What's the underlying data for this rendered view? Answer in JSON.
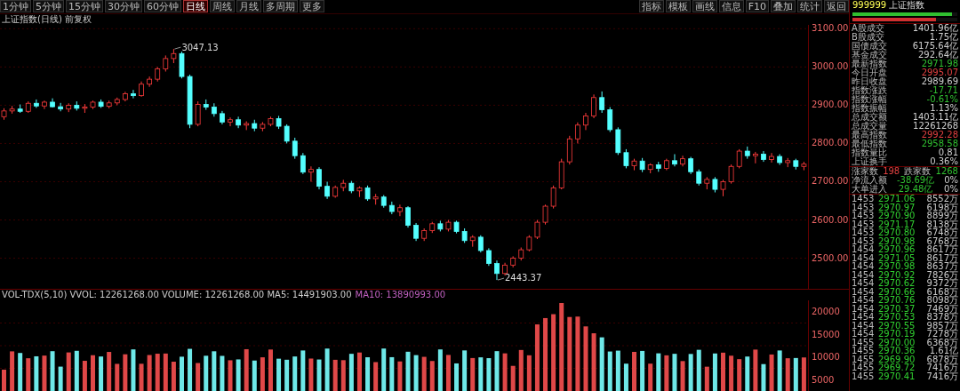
{
  "toolbar": {
    "periods": [
      {
        "label": "1分钟",
        "selected": false
      },
      {
        "label": "5分钟",
        "selected": false
      },
      {
        "label": "15分钟",
        "selected": false
      },
      {
        "label": "30分钟",
        "selected": false
      },
      {
        "label": "60分钟",
        "selected": false
      },
      {
        "label": "日线",
        "selected": true
      },
      {
        "label": "周线",
        "selected": false
      },
      {
        "label": "月线",
        "selected": false
      },
      {
        "label": "多周期",
        "selected": false
      },
      {
        "label": "更多",
        "selected": false
      }
    ],
    "tools": [
      "指标",
      "模板",
      "画线",
      "信息",
      "F10",
      "叠加",
      "统计",
      "返回"
    ]
  },
  "chart": {
    "title": "上证指数(日线)",
    "adjust": "前复权",
    "high_label": "3047.13",
    "low_label": "2443.37",
    "chart_data": {
      "type": "candlestick",
      "ylim": [
        2420,
        3110
      ],
      "grid": true,
      "yticks": [
        {
          "value": 3100,
          "label": "3100.00"
        },
        {
          "value": 3000,
          "label": "3000.00"
        },
        {
          "value": 2900,
          "label": "2900.00"
        },
        {
          "value": 2800,
          "label": "2800.00"
        },
        {
          "value": 2700,
          "label": "2700.00"
        },
        {
          "value": 2600,
          "label": "2600.00"
        },
        {
          "value": 2500,
          "label": "2500.00"
        }
      ],
      "ohlc": [
        [
          2870,
          2892,
          2862,
          2885
        ],
        [
          2885,
          2898,
          2878,
          2890
        ],
        [
          2890,
          2902,
          2880,
          2884
        ],
        [
          2884,
          2910,
          2880,
          2905
        ],
        [
          2905,
          2915,
          2893,
          2898
        ],
        [
          2898,
          2912,
          2890,
          2908
        ],
        [
          2908,
          2918,
          2894,
          2896
        ],
        [
          2896,
          2906,
          2884,
          2890
        ],
        [
          2890,
          2905,
          2882,
          2900
        ],
        [
          2900,
          2910,
          2886,
          2892
        ],
        [
          2892,
          2903,
          2880,
          2895
        ],
        [
          2895,
          2912,
          2890,
          2908
        ],
        [
          2908,
          2915,
          2893,
          2897
        ],
        [
          2897,
          2912,
          2892,
          2906
        ],
        [
          2906,
          2920,
          2900,
          2915
        ],
        [
          2915,
          2935,
          2910,
          2930
        ],
        [
          2930,
          2940,
          2918,
          2925
        ],
        [
          2925,
          2962,
          2922,
          2955
        ],
        [
          2955,
          2975,
          2948,
          2968
        ],
        [
          2968,
          3000,
          2962,
          2995
        ],
        [
          2995,
          3030,
          2988,
          3022
        ],
        [
          3022,
          3047,
          3010,
          3035
        ],
        [
          3035,
          3040,
          2970,
          2975
        ],
        [
          2975,
          2980,
          2840,
          2850
        ],
        [
          2850,
          2910,
          2845,
          2902
        ],
        [
          2902,
          2915,
          2888,
          2895
        ],
        [
          2895,
          2905,
          2870,
          2878
        ],
        [
          2878,
          2885,
          2850,
          2856
        ],
        [
          2856,
          2868,
          2845,
          2862
        ],
        [
          2862,
          2870,
          2840,
          2848
        ],
        [
          2848,
          2858,
          2835,
          2852
        ],
        [
          2852,
          2862,
          2832,
          2840
        ],
        [
          2840,
          2856,
          2832,
          2850
        ],
        [
          2850,
          2870,
          2845,
          2865
        ],
        [
          2865,
          2872,
          2838,
          2845
        ],
        [
          2845,
          2850,
          2800,
          2806
        ],
        [
          2806,
          2815,
          2760,
          2768
        ],
        [
          2768,
          2775,
          2720,
          2725
        ],
        [
          2725,
          2740,
          2700,
          2732
        ],
        [
          2732,
          2738,
          2680,
          2688
        ],
        [
          2688,
          2700,
          2655,
          2662
        ],
        [
          2662,
          2690,
          2658,
          2685
        ],
        [
          2685,
          2705,
          2675,
          2696
        ],
        [
          2696,
          2702,
          2670,
          2676
        ],
        [
          2676,
          2688,
          2660,
          2684
        ],
        [
          2684,
          2690,
          2650,
          2655
        ],
        [
          2655,
          2668,
          2640,
          2660
        ],
        [
          2660,
          2665,
          2632,
          2638
        ],
        [
          2638,
          2648,
          2615,
          2622
        ],
        [
          2622,
          2640,
          2610,
          2632
        ],
        [
          2632,
          2636,
          2580,
          2586
        ],
        [
          2586,
          2592,
          2545,
          2552
        ],
        [
          2552,
          2578,
          2545,
          2572
        ],
        [
          2572,
          2595,
          2566,
          2590
        ],
        [
          2590,
          2598,
          2570,
          2576
        ],
        [
          2576,
          2600,
          2570,
          2594
        ],
        [
          2594,
          2598,
          2565,
          2570
        ],
        [
          2570,
          2578,
          2540,
          2546
        ],
        [
          2546,
          2560,
          2530,
          2555
        ],
        [
          2555,
          2560,
          2515,
          2520
        ],
        [
          2520,
          2526,
          2480,
          2486
        ],
        [
          2486,
          2494,
          2443,
          2460
        ],
        [
          2460,
          2488,
          2455,
          2482
        ],
        [
          2482,
          2505,
          2476,
          2500
        ],
        [
          2500,
          2528,
          2494,
          2522
        ],
        [
          2522,
          2560,
          2518,
          2555
        ],
        [
          2555,
          2600,
          2550,
          2594
        ],
        [
          2594,
          2640,
          2588,
          2636
        ],
        [
          2636,
          2690,
          2630,
          2684
        ],
        [
          2684,
          2760,
          2680,
          2752
        ],
        [
          2752,
          2820,
          2745,
          2812
        ],
        [
          2812,
          2855,
          2800,
          2848
        ],
        [
          2848,
          2880,
          2835,
          2872
        ],
        [
          2872,
          2928,
          2866,
          2920
        ],
        [
          2920,
          2936,
          2880,
          2888
        ],
        [
          2888,
          2895,
          2830,
          2836
        ],
        [
          2836,
          2842,
          2770,
          2776
        ],
        [
          2776,
          2785,
          2735,
          2742
        ],
        [
          2742,
          2760,
          2730,
          2754
        ],
        [
          2754,
          2762,
          2725,
          2732
        ],
        [
          2732,
          2748,
          2722,
          2744
        ],
        [
          2744,
          2752,
          2726,
          2735
        ],
        [
          2735,
          2760,
          2730,
          2755
        ],
        [
          2755,
          2772,
          2740,
          2746
        ],
        [
          2746,
          2768,
          2740,
          2760
        ],
        [
          2760,
          2765,
          2720,
          2726
        ],
        [
          2726,
          2732,
          2690,
          2696
        ],
        [
          2696,
          2712,
          2680,
          2706
        ],
        [
          2706,
          2712,
          2672,
          2680
        ],
        [
          2680,
          2705,
          2662,
          2700
        ],
        [
          2700,
          2745,
          2695,
          2740
        ],
        [
          2740,
          2785,
          2735,
          2780
        ],
        [
          2780,
          2792,
          2760,
          2768
        ],
        [
          2768,
          2778,
          2748,
          2772
        ],
        [
          2772,
          2780,
          2752,
          2758
        ],
        [
          2758,
          2775,
          2750,
          2766
        ],
        [
          2766,
          2772,
          2744,
          2750
        ],
        [
          2750,
          2762,
          2738,
          2755
        ],
        [
          2755,
          2760,
          2732,
          2740
        ],
        [
          2740,
          2752,
          2730,
          2746
        ]
      ]
    }
  },
  "volume": {
    "header": "VOL-TDX(5,10) VVOL: 12261268.00 VOLUME: 12261268.00 MA5: 14491903.00",
    "header_highlight": "MA10: 13890993.00",
    "axis": [
      "20000",
      "15000",
      "10000",
      "5000"
    ]
  },
  "quote": {
    "code": "999999",
    "name": "上证指数",
    "meters": [
      {
        "kind": "buy",
        "level": 0.95
      },
      {
        "kind": "sell",
        "level": 0.8
      }
    ],
    "stats": [
      {
        "label": "A股成交",
        "value": "1401.96亿",
        "color": "#d0d0d0"
      },
      {
        "label": "B股成交",
        "value": "1.75亿",
        "color": "#d0d0d0"
      },
      {
        "label": "国债成交",
        "value": "6175.64亿",
        "color": "#d0d0d0"
      },
      {
        "label": "基金成交",
        "value": "292.64亿",
        "color": "#d0d0d0"
      },
      {
        "label": "最新指数",
        "value": "2971.98",
        "color": "#30c030"
      },
      {
        "label": "今日开盘",
        "value": "2995.07",
        "color": "#e04040"
      },
      {
        "label": "昨日收盘",
        "value": "2989.69",
        "color": "#d0d0d0"
      },
      {
        "label": "指数涨跌",
        "value": "-17.71",
        "color": "#30c030"
      },
      {
        "label": "指数涨幅",
        "value": "-0.61%",
        "color": "#30c030"
      },
      {
        "label": "指数振幅",
        "value": "1.13%",
        "color": "#d0d0d0"
      },
      {
        "label": "总成交额",
        "value": "1403.11亿",
        "color": "#d0d0d0"
      },
      {
        "label": "总成交量",
        "value": "12261268",
        "color": "#d0d0d0"
      },
      {
        "label": "最高指数",
        "value": "2992.28",
        "color": "#e04040"
      },
      {
        "label": "最低指数",
        "value": "2958.58",
        "color": "#30c030"
      },
      {
        "label": "指数量比",
        "value": "0.81",
        "color": "#d0d0d0"
      },
      {
        "label": "上证换手",
        "value": "0.36%",
        "color": "#d0d0d0"
      }
    ],
    "breadth": {
      "up_label": "涨家数",
      "up": "198",
      "down_label": "跌家数",
      "down": "1268"
    },
    "flows": [
      {
        "label": "净流入额",
        "value": "-38.69亿",
        "pct": "0%"
      },
      {
        "label": "大单进入",
        "value": "29.48亿",
        "pct": "0%"
      }
    ],
    "ticks": [
      {
        "time": "1453",
        "price": "2971.06",
        "volume": "8552万"
      },
      {
        "time": "1453",
        "price": "2970.97",
        "volume": "6198万"
      },
      {
        "time": "1453",
        "price": "2970.90",
        "volume": "8899万"
      },
      {
        "time": "1453",
        "price": "2971.17",
        "volume": "8138万"
      },
      {
        "time": "1453",
        "price": "2970.80",
        "volume": "6748万"
      },
      {
        "time": "1453",
        "price": "2970.98",
        "volume": "6768万"
      },
      {
        "time": "1454",
        "price": "2970.96",
        "volume": "8617万"
      },
      {
        "time": "1454",
        "price": "2971.05",
        "volume": "8617万"
      },
      {
        "time": "1454",
        "price": "2970.98",
        "volume": "8637万"
      },
      {
        "time": "1454",
        "price": "2970.92",
        "volume": "7826万"
      },
      {
        "time": "1454",
        "price": "2970.62",
        "volume": "9372万"
      },
      {
        "time": "1454",
        "price": "2970.66",
        "volume": "6168万"
      },
      {
        "time": "1454",
        "price": "2970.76",
        "volume": "8098万"
      },
      {
        "time": "1454",
        "price": "2970.37",
        "volume": "7469万"
      },
      {
        "time": "1454",
        "price": "2970.53",
        "volume": "8378万"
      },
      {
        "time": "1454",
        "price": "2970.55",
        "volume": "9857万"
      },
      {
        "time": "1454",
        "price": "2970.19",
        "volume": "7278万"
      },
      {
        "time": "1455",
        "price": "2970.00",
        "volume": "6368万"
      },
      {
        "time": "1455",
        "price": "2970.36",
        "volume": "1.61亿"
      },
      {
        "time": "1455",
        "price": "2969.90",
        "volume": "6878万"
      },
      {
        "time": "1455",
        "price": "2969.72",
        "volume": "7416万"
      },
      {
        "time": "1455",
        "price": "2970.41",
        "volume": "7416万"
      }
    ]
  }
}
